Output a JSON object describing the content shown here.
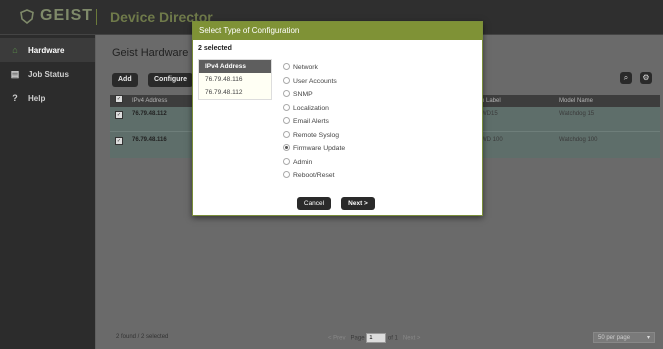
{
  "app": {
    "logo_text": "GEIST",
    "title": "Device Director"
  },
  "sidebar": {
    "items": [
      {
        "label": "Hardware",
        "icon": "home-icon",
        "glyph": "⌂"
      },
      {
        "label": "Job Status",
        "icon": "clipboard-icon",
        "glyph": "▤"
      },
      {
        "label": "Help",
        "icon": "question-icon",
        "glyph": "?"
      }
    ]
  },
  "main": {
    "title": "Geist Hardware",
    "add_label": "Add",
    "configure_label": "Configure",
    "search_glyph": "⌕",
    "settings_glyph": "⚙",
    "columns": [
      "IPv4 Address",
      "n Label",
      "Model Name"
    ],
    "rows": [
      {
        "ip": "76.79.48.112",
        "label": "WD15",
        "model": "Watchdog 15"
      },
      {
        "ip": "76.79.48.116",
        "label": "WD 100",
        "model": "Watchdog 100"
      }
    ],
    "footer_count": "2 found / 2 selected",
    "pager": {
      "prev": "< Prev",
      "page_label": "Page",
      "page_value": "1",
      "of": "of 1",
      "next": "Next >"
    },
    "per_page": "50 per page"
  },
  "dialog": {
    "title": "Select Type of Configuration",
    "selected_count": "2 selected",
    "ip_header": "IPv4 Address",
    "ips": [
      "76.79.48.116",
      "76.79.48.112"
    ],
    "options": [
      {
        "label": "Network",
        "checked": false
      },
      {
        "label": "User Accounts",
        "checked": false
      },
      {
        "label": "SNMP",
        "checked": false
      },
      {
        "label": "Localization",
        "checked": false
      },
      {
        "label": "Email Alerts",
        "checked": false
      },
      {
        "label": "Remote Syslog",
        "checked": false
      },
      {
        "label": "Firmware Update",
        "checked": true
      },
      {
        "label": "Admin",
        "checked": false
      },
      {
        "label": "Reboot/Reset",
        "checked": false
      }
    ],
    "cancel_label": "Cancel",
    "next_label": "Next >"
  },
  "colors": {
    "accent": "#7f9236",
    "row_bg": "#5e6e6a"
  }
}
